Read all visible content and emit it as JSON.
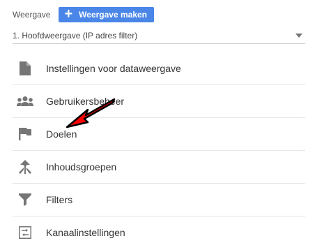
{
  "header": {
    "label": "Weergave",
    "create_button_label": "Weergave maken"
  },
  "view_select": {
    "value": "1. Hoofdweergave (IP adres filter)"
  },
  "menu": {
    "items": [
      {
        "label": "Instellingen voor dataweergave",
        "icon": "document-icon"
      },
      {
        "label": "Gebruikersbeheer",
        "icon": "users-icon"
      },
      {
        "label": "Doelen",
        "icon": "flag-icon"
      },
      {
        "label": "Inhoudsgroepen",
        "icon": "content-grouping-icon"
      },
      {
        "label": "Filters",
        "icon": "filter-icon"
      },
      {
        "label": "Kanaalinstellingen",
        "icon": "channel-settings-icon"
      }
    ]
  },
  "colors": {
    "accent": "#4a86e8",
    "icon": "#757575",
    "annotation_arrow": "#ff0000"
  }
}
